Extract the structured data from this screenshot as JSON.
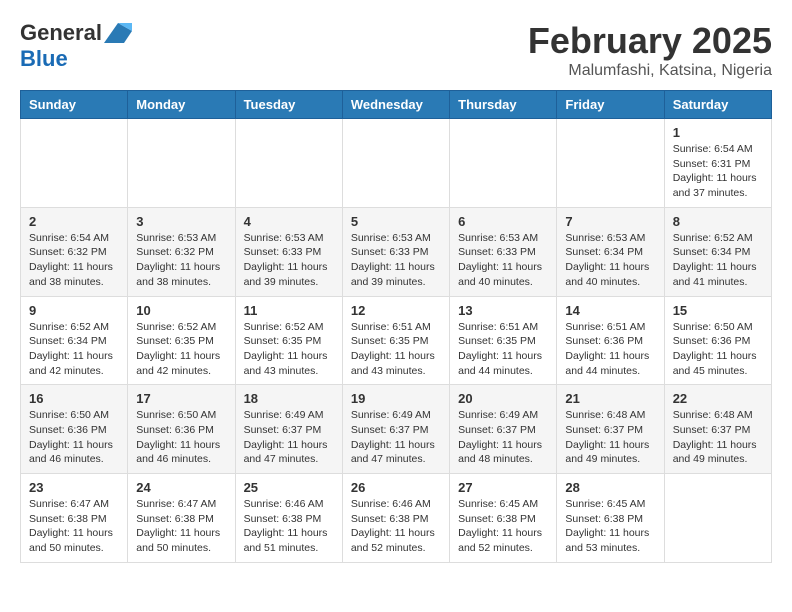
{
  "header": {
    "logo_general": "General",
    "logo_blue": "Blue",
    "month_year": "February 2025",
    "location": "Malumfashi, Katsina, Nigeria"
  },
  "days_of_week": [
    "Sunday",
    "Monday",
    "Tuesday",
    "Wednesday",
    "Thursday",
    "Friday",
    "Saturday"
  ],
  "weeks": [
    [
      {
        "day": "",
        "info": ""
      },
      {
        "day": "",
        "info": ""
      },
      {
        "day": "",
        "info": ""
      },
      {
        "day": "",
        "info": ""
      },
      {
        "day": "",
        "info": ""
      },
      {
        "day": "",
        "info": ""
      },
      {
        "day": "1",
        "info": "Sunrise: 6:54 AM\nSunset: 6:31 PM\nDaylight: 11 hours and 37 minutes."
      }
    ],
    [
      {
        "day": "2",
        "info": "Sunrise: 6:54 AM\nSunset: 6:32 PM\nDaylight: 11 hours and 38 minutes."
      },
      {
        "day": "3",
        "info": "Sunrise: 6:53 AM\nSunset: 6:32 PM\nDaylight: 11 hours and 38 minutes."
      },
      {
        "day": "4",
        "info": "Sunrise: 6:53 AM\nSunset: 6:33 PM\nDaylight: 11 hours and 39 minutes."
      },
      {
        "day": "5",
        "info": "Sunrise: 6:53 AM\nSunset: 6:33 PM\nDaylight: 11 hours and 39 minutes."
      },
      {
        "day": "6",
        "info": "Sunrise: 6:53 AM\nSunset: 6:33 PM\nDaylight: 11 hours and 40 minutes."
      },
      {
        "day": "7",
        "info": "Sunrise: 6:53 AM\nSunset: 6:34 PM\nDaylight: 11 hours and 40 minutes."
      },
      {
        "day": "8",
        "info": "Sunrise: 6:52 AM\nSunset: 6:34 PM\nDaylight: 11 hours and 41 minutes."
      }
    ],
    [
      {
        "day": "9",
        "info": "Sunrise: 6:52 AM\nSunset: 6:34 PM\nDaylight: 11 hours and 42 minutes."
      },
      {
        "day": "10",
        "info": "Sunrise: 6:52 AM\nSunset: 6:35 PM\nDaylight: 11 hours and 42 minutes."
      },
      {
        "day": "11",
        "info": "Sunrise: 6:52 AM\nSunset: 6:35 PM\nDaylight: 11 hours and 43 minutes."
      },
      {
        "day": "12",
        "info": "Sunrise: 6:51 AM\nSunset: 6:35 PM\nDaylight: 11 hours and 43 minutes."
      },
      {
        "day": "13",
        "info": "Sunrise: 6:51 AM\nSunset: 6:35 PM\nDaylight: 11 hours and 44 minutes."
      },
      {
        "day": "14",
        "info": "Sunrise: 6:51 AM\nSunset: 6:36 PM\nDaylight: 11 hours and 44 minutes."
      },
      {
        "day": "15",
        "info": "Sunrise: 6:50 AM\nSunset: 6:36 PM\nDaylight: 11 hours and 45 minutes."
      }
    ],
    [
      {
        "day": "16",
        "info": "Sunrise: 6:50 AM\nSunset: 6:36 PM\nDaylight: 11 hours and 46 minutes."
      },
      {
        "day": "17",
        "info": "Sunrise: 6:50 AM\nSunset: 6:36 PM\nDaylight: 11 hours and 46 minutes."
      },
      {
        "day": "18",
        "info": "Sunrise: 6:49 AM\nSunset: 6:37 PM\nDaylight: 11 hours and 47 minutes."
      },
      {
        "day": "19",
        "info": "Sunrise: 6:49 AM\nSunset: 6:37 PM\nDaylight: 11 hours and 47 minutes."
      },
      {
        "day": "20",
        "info": "Sunrise: 6:49 AM\nSunset: 6:37 PM\nDaylight: 11 hours and 48 minutes."
      },
      {
        "day": "21",
        "info": "Sunrise: 6:48 AM\nSunset: 6:37 PM\nDaylight: 11 hours and 49 minutes."
      },
      {
        "day": "22",
        "info": "Sunrise: 6:48 AM\nSunset: 6:37 PM\nDaylight: 11 hours and 49 minutes."
      }
    ],
    [
      {
        "day": "23",
        "info": "Sunrise: 6:47 AM\nSunset: 6:38 PM\nDaylight: 11 hours and 50 minutes."
      },
      {
        "day": "24",
        "info": "Sunrise: 6:47 AM\nSunset: 6:38 PM\nDaylight: 11 hours and 50 minutes."
      },
      {
        "day": "25",
        "info": "Sunrise: 6:46 AM\nSunset: 6:38 PM\nDaylight: 11 hours and 51 minutes."
      },
      {
        "day": "26",
        "info": "Sunrise: 6:46 AM\nSunset: 6:38 PM\nDaylight: 11 hours and 52 minutes."
      },
      {
        "day": "27",
        "info": "Sunrise: 6:45 AM\nSunset: 6:38 PM\nDaylight: 11 hours and 52 minutes."
      },
      {
        "day": "28",
        "info": "Sunrise: 6:45 AM\nSunset: 6:38 PM\nDaylight: 11 hours and 53 minutes."
      },
      {
        "day": "",
        "info": ""
      }
    ]
  ]
}
